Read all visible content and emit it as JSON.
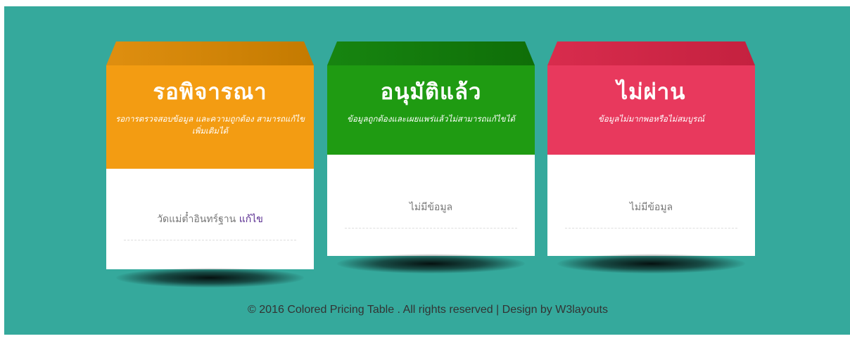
{
  "cards": [
    {
      "title": "รอพิจารณา",
      "description": "รอการตรวจสอบข้อมูล และความถูกต้อง สามารถแก้ไขเพิ่มเติมได้",
      "item_text": "วัดแม่ต๋ำอินทร์ฐาน",
      "edit_label": "แก้ไข",
      "color": "#f39c12",
      "roof_dark": "#c47a00",
      "roof_light": "#df8f10"
    },
    {
      "title": "อนุมัติแล้ว",
      "description": "ข้อมูลถูกต้องและเผยแพร่แล้วไม่สามารถแก้ไขได้",
      "item_text": "ไม่มีข้อมูล",
      "color": "#1f9b12",
      "roof_dark": "#0f6e08",
      "roof_light": "#178510"
    },
    {
      "title": "ไม่ผ่าน",
      "description": "ข้อมูลไม่มากพอหรือไม่สมบูรณ์",
      "item_text": "ไม่มีข้อมูล",
      "color": "#e8395d",
      "roof_dark": "#c4213f",
      "roof_light": "#d82c4d"
    }
  ],
  "footer": "© 2016 Colored Pricing Table . All rights reserved | Design by W3layouts"
}
